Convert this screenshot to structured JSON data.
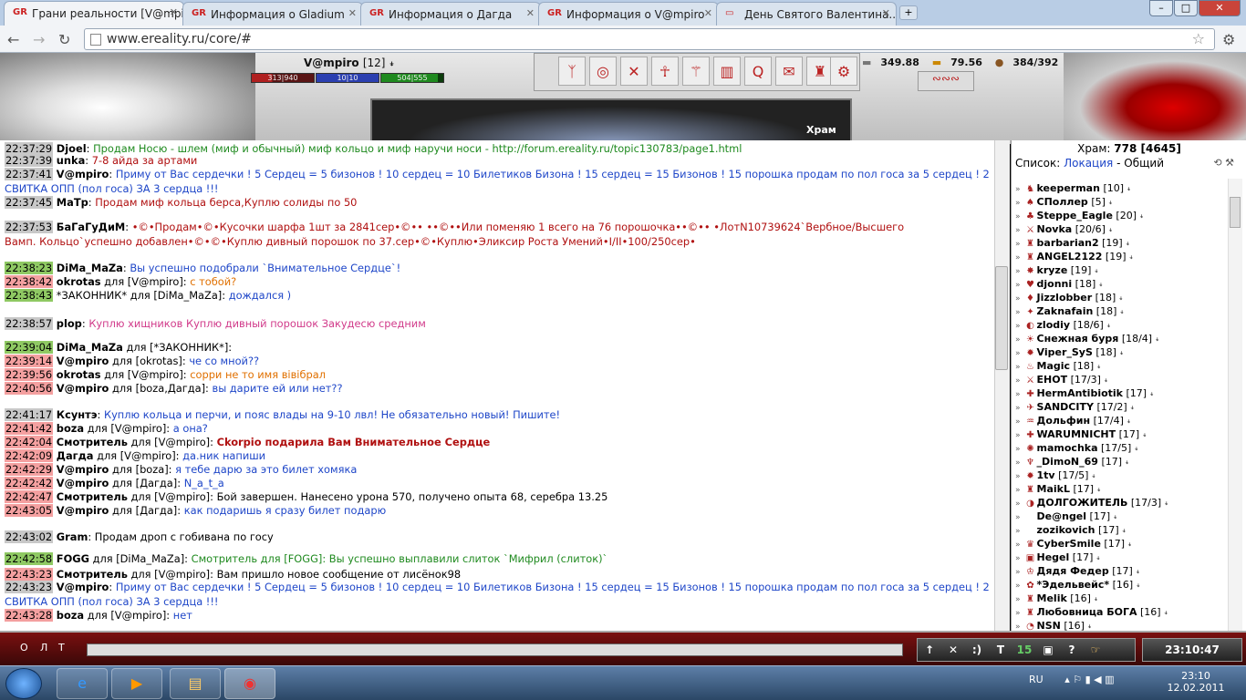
{
  "browser": {
    "tabs": [
      {
        "title": "Грани реальности [V@mpiro]"
      },
      {
        "title": "Информация о Gladium"
      },
      {
        "title": "Информация о Дагда"
      },
      {
        "title": "Информация о V@mpiro"
      },
      {
        "title": "День Святого Валентина..."
      }
    ],
    "url": "www.ereality.ru/core/#"
  },
  "player": {
    "name": "V@mpiro",
    "level": "[12]",
    "hp": "313|940",
    "mana": "10|10",
    "energy": "504|555"
  },
  "resources": {
    "silver": "349.88",
    "gold": "79.56",
    "capacity": "384/392"
  },
  "location_label": "Храм",
  "chat": [
    {
      "time": "22:37:29",
      "tc": "gr",
      "nick": "Djoel",
      "rest": ": ",
      "msg": "Продам Носю - шлем (миф и обычный) миф кольцо и миф наручи носи - http://forum.ereality.ru/topic130783/page1.html",
      "cls": "green"
    },
    {
      "time": "22:37:39",
      "tc": "gr",
      "nick": "unka",
      "rest": ": ",
      "msg": "7-8 айда за артами",
      "cls": "dred"
    },
    {
      "time": "22:37:41",
      "tc": "gr",
      "nick": "V@mpiro",
      "rest": ": ",
      "msg": "Приму от Вас сердечки ! 5 Сердец = 5 бизонов ! 10 сердец = 10 Билетиков Бизона ! 15 сердец = 15 Бизонов ! 15 порошка продам по пол госа за 5 сердец ! 2",
      "cls": "blue"
    },
    {
      "time": "",
      "tc": "",
      "nick": "",
      "rest": "",
      "msg": "СВИТКА ОПП (пол госа) ЗА 3 сердца !!!",
      "cls": "blue"
    },
    {
      "time": "22:37:45",
      "tc": "gr",
      "nick": "МаТр",
      "rest": ": ",
      "msg": "Продам миф кольца берса,Куплю солиды по 50",
      "cls": "dred"
    },
    {
      "time": "22:37:53",
      "tc": "gr",
      "nick": "БаГаГуДиМ",
      "rest": ": ",
      "msg": "•©•Продам•©•Кусочки шарфа 1шт за 2841сер•©•• ••©••Или поменяю 1 всего на 76 порошочка••©•• •ЛотN10739624`Вербное/Высшего",
      "cls": "dred"
    },
    {
      "time": "",
      "tc": "",
      "nick": "",
      "rest": "",
      "msg": "Вамп. Кольцо`успешно добавлен•©•©•Куплю дивный порошок по 37.сер•©•Куплю•Эликсир Роста Умений•I/II•100/250сер•",
      "cls": "dred"
    },
    {
      "time": "22:38:23",
      "tc": "g",
      "nick": "DiMa_MaZa",
      "rest": ": ",
      "msg": "Вы успешно подобрали `Внимательное Сердце`!",
      "cls": "blue"
    },
    {
      "time": "22:38:42",
      "tc": "r",
      "nick": "okrotas",
      "rest": " для [V@mpiro]: ",
      "msg": "с тобой?",
      "cls": "orange"
    },
    {
      "time": "22:38:43",
      "tc": "g",
      "nick": "",
      "rest": "*ЗАКОННИК* для [DiMa_MaZa]: ",
      "msg": "дождался )",
      "cls": "blue"
    },
    {
      "time": "22:38:57",
      "tc": "gr",
      "nick": "plop",
      "rest": ": ",
      "msg": "Куплю хищников    Куплю дивный порошок    Закудесю средним",
      "cls": "pink"
    },
    {
      "time": "22:39:04",
      "tc": "g",
      "nick": "DiMa_MaZa",
      "rest": " для [*ЗАКОННИК*]: ",
      "msg": "",
      "cls": "blue"
    },
    {
      "time": "22:39:14",
      "tc": "r",
      "nick": "V@mpiro",
      "rest": " для [okrotas]: ",
      "msg": "че со мной??",
      "cls": "blue"
    },
    {
      "time": "22:39:56",
      "tc": "r",
      "nick": "okrotas",
      "rest": " для [V@mpiro]: ",
      "msg": "сорри не то имя вівібрал",
      "cls": "orange"
    },
    {
      "time": "22:40:56",
      "tc": "r",
      "nick": "V@mpiro",
      "rest": " для [boza,Дагда]: ",
      "msg": "вы дарите ей или нет??",
      "cls": "blue"
    },
    {
      "time": "22:41:17",
      "tc": "gr",
      "nick": "Ксунтэ",
      "rest": ": ",
      "msg": "Куплю кольца и перчи, и пояс влады на 9-10 лвл! Не обязательно новый! Пишите!",
      "cls": "blue"
    },
    {
      "time": "22:41:42",
      "tc": "r",
      "nick": "boza",
      "rest": " для [V@mpiro]: ",
      "msg": "а она?",
      "cls": "blue"
    },
    {
      "time": "22:42:04",
      "tc": "r",
      "nick": "Смотритель",
      "rest": " для [V@mpiro]: ",
      "msg": "Ckorpio подарила Вам Внимательное Сердце",
      "cls": "dred"
    },
    {
      "time": "22:42:09",
      "tc": "r",
      "nick": "Дагда",
      "rest": " для [V@mpiro]: ",
      "msg": "да.ник напиши",
      "cls": "blue"
    },
    {
      "time": "22:42:29",
      "tc": "r",
      "nick": "V@mpiro",
      "rest": " для [boza]: ",
      "msg": "я тебе дарю за это билет хомяка",
      "cls": "blue"
    },
    {
      "time": "22:42:42",
      "tc": "r",
      "nick": "V@mpiro",
      "rest": " для [Дагда]: ",
      "msg": "N_a_t_a",
      "cls": "blue"
    },
    {
      "time": "22:42:47",
      "tc": "r",
      "nick": "Смотритель",
      "rest": " для [V@mpiro]: ",
      "msg": "Бой завершен. Нанесено урона 570, получено опыта 68, серебра 13.25",
      "cls": "black"
    },
    {
      "time": "22:43:05",
      "tc": "r",
      "nick": "V@mpiro",
      "rest": " для [Дагда]: ",
      "msg": "как подаришь я сразу билет подарю",
      "cls": "blue"
    },
    {
      "time": "22:43:02",
      "tc": "gr",
      "nick": "Gram",
      "rest": ": ",
      "msg": "Продам дроп с гобивана по госу",
      "cls": "black"
    },
    {
      "time": "22:42:58",
      "tc": "g",
      "nick": "FOGG",
      "rest": " для [DiMa_MaZa]: ",
      "msg": "Смотритель для [FOGG]: Вы успешно выплавили слиток `Мифрил (слиток)`",
      "cls": "green"
    },
    {
      "time": "22:43:23",
      "tc": "r",
      "nick": "Смотритель",
      "rest": " для [V@mpiro]: ",
      "msg": "Вам пришло новое сообщение от лисёнок98",
      "cls": "black"
    },
    {
      "time": "22:43:23",
      "tc": "gr",
      "nick": "V@mpiro",
      "rest": ": ",
      "msg": "Приму от Вас сердечки ! 5 Сердец = 5 бизонов ! 10 сердец = 10 Билетиков Бизона ! 15 сердец = 15 Бизонов ! 15 порошка продам по пол госа за 5 сердец ! 2",
      "cls": "blue"
    },
    {
      "time": "",
      "tc": "",
      "nick": "",
      "rest": "",
      "msg": "СВИТКА ОПП (пол госа) ЗА 3 сердца !!!",
      "cls": "blue"
    },
    {
      "time": "22:43:28",
      "tc": "r",
      "nick": "boza",
      "rest": " для [V@mpiro]: ",
      "msg": "нет",
      "cls": "blue"
    }
  ],
  "online": {
    "location_label": "Храм:",
    "count": "778 [4645]",
    "list_label": "Список:",
    "mode_location": "Локация",
    "mode_separator": "-",
    "mode_general": "Общий",
    "users": [
      {
        "name": "keeperman",
        "level": "[10]"
      },
      {
        "name": "СПоллер",
        "level": "[5]"
      },
      {
        "name": "Steppe_Eagle",
        "level": "[20]"
      },
      {
        "name": "Novka",
        "level": "[20/6]"
      },
      {
        "name": "barbarian2",
        "level": "[19]"
      },
      {
        "name": "ANGEL2122",
        "level": "[19]"
      },
      {
        "name": "kryze",
        "level": "[19]"
      },
      {
        "name": "djonni",
        "level": "[18]"
      },
      {
        "name": "Jizzlobber",
        "level": "[18]"
      },
      {
        "name": "Zaknafain",
        "level": "[18]"
      },
      {
        "name": "zlodiy",
        "level": "[18/6]"
      },
      {
        "name": "Снежная буря",
        "level": "[18/4]"
      },
      {
        "name": "Viper_SyS",
        "level": "[18]"
      },
      {
        "name": "Magic",
        "level": "[18]"
      },
      {
        "name": "EHOT",
        "level": "[17/3]"
      },
      {
        "name": "HermAntibiotik",
        "level": "[17]"
      },
      {
        "name": "SANDCITY",
        "level": "[17/2]"
      },
      {
        "name": "Дольфин",
        "level": "[17/4]"
      },
      {
        "name": "WARUMNICHT",
        "level": "[17]"
      },
      {
        "name": "mamochka",
        "level": "[17/5]"
      },
      {
        "name": "_DimoN_69",
        "level": "[17]"
      },
      {
        "name": "1tv",
        "level": "[17/5]"
      },
      {
        "name": "MaikL",
        "level": "[17]"
      },
      {
        "name": "ДОЛГОЖИТЕЛЬ",
        "level": "[17/3]"
      },
      {
        "name": "De@ngel",
        "level": "[17]"
      },
      {
        "name": "zozikovich",
        "level": "[17]"
      },
      {
        "name": "CyberSmile",
        "level": "[17]"
      },
      {
        "name": "Hegel",
        "level": "[17]"
      },
      {
        "name": "Дядя Федер",
        "level": "[17]"
      },
      {
        "name": "*Эдельвейс*",
        "level": "[16]"
      },
      {
        "name": "Melik",
        "level": "[16]"
      },
      {
        "name": "Любовница БОГА",
        "level": "[16]"
      },
      {
        "name": "NSN",
        "level": "[16]"
      }
    ]
  },
  "bottom": {
    "left_labels": [
      "О",
      "Л",
      "Т"
    ],
    "tools": [
      "↑",
      "✕",
      ":)",
      "T",
      "15",
      "▣",
      "?",
      "☞"
    ],
    "clock": "23:10:47"
  },
  "taskbar": {
    "lang": "RU",
    "time": "23:10",
    "date": "12.02.2011"
  }
}
